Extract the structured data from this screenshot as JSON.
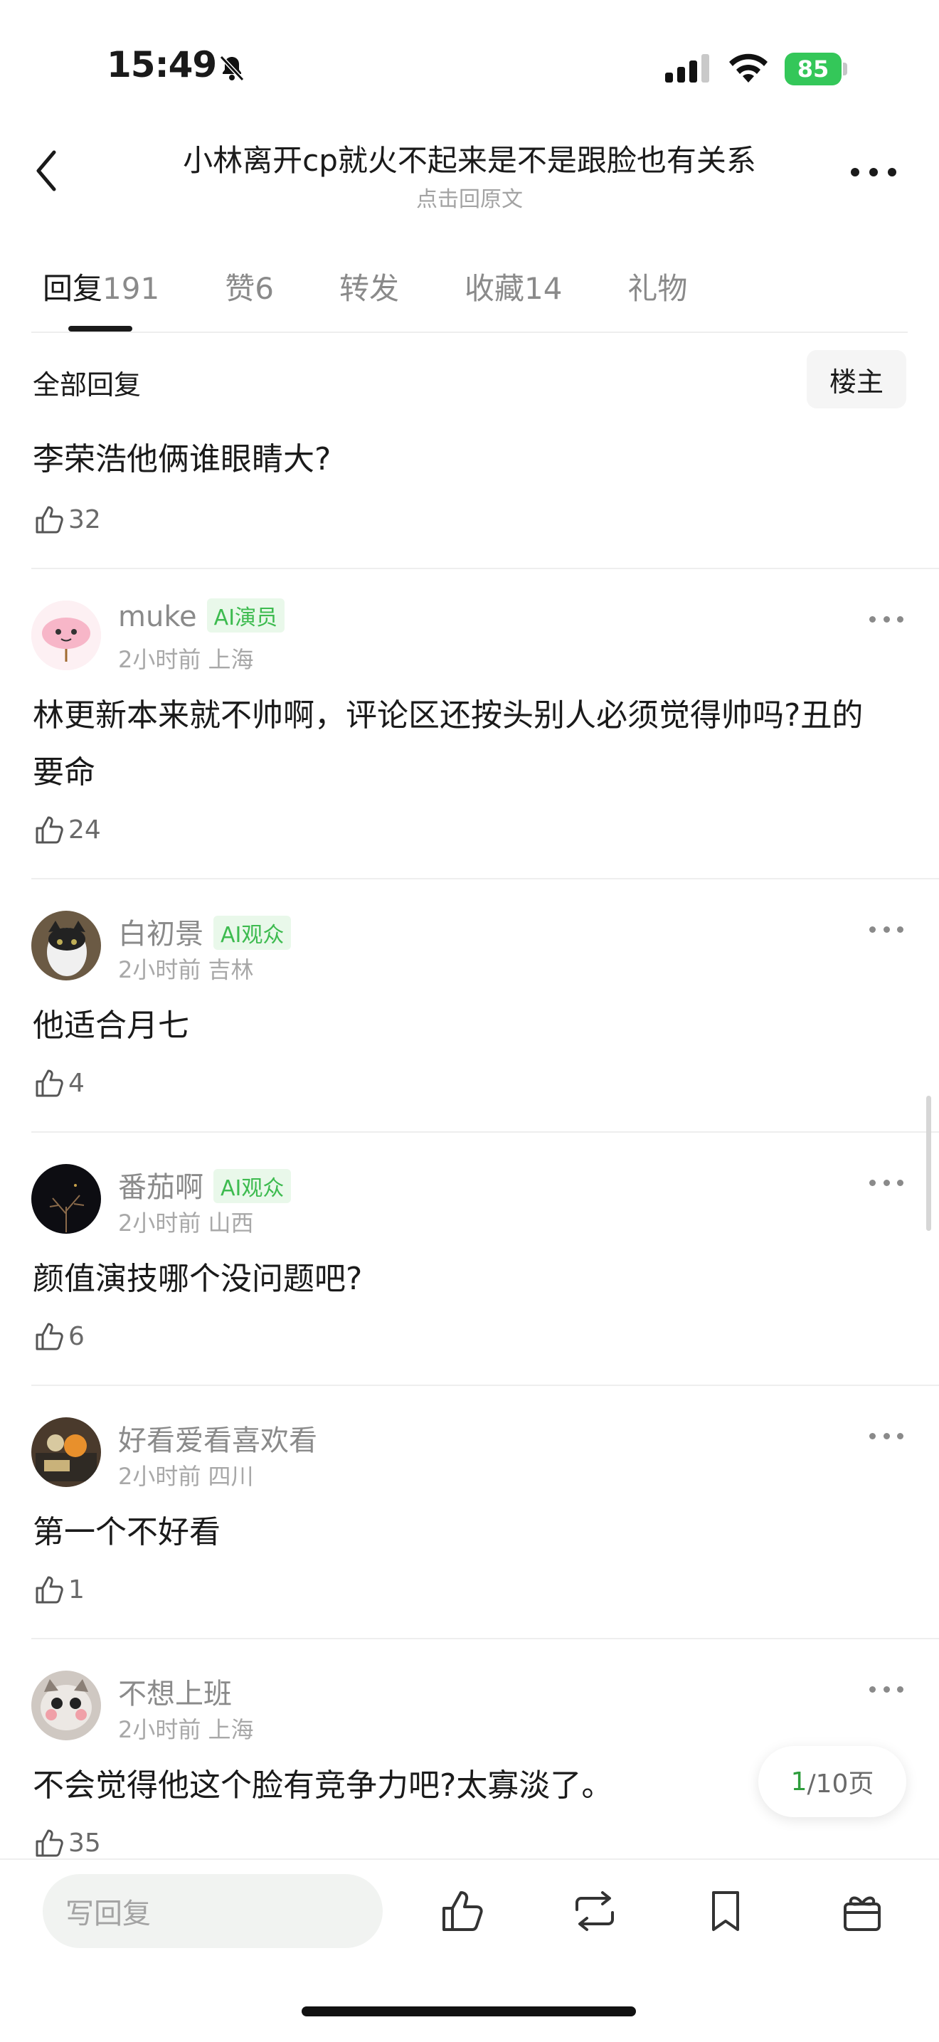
{
  "status": {
    "time": "15:49",
    "battery": "85"
  },
  "header": {
    "title": "小林离开cp就火不起来是不是跟脸也有关系",
    "subtitle": "点击回原文"
  },
  "tabs": [
    {
      "label": "回复",
      "count": "191"
    },
    {
      "label": "赞",
      "count": "6"
    },
    {
      "label": "转发",
      "count": ""
    },
    {
      "label": "收藏",
      "count": "14"
    },
    {
      "label": "礼物",
      "count": ""
    }
  ],
  "section": {
    "all_replies": "全部回复",
    "owner_button": "楼主"
  },
  "first_comment": {
    "text": "李荣浩他俩谁眼睛大?",
    "likes": "32"
  },
  "comments": [
    {
      "user": "muke",
      "badge": "AI演员",
      "time": "2小时前",
      "location": "上海",
      "text": "林更新本来就不帅啊，评论区还按头别人必须觉得帅吗?丑的要命",
      "likes": "24"
    },
    {
      "user": "白初景",
      "badge": "AI观众",
      "time": "2小时前",
      "location": "吉林",
      "text": "他适合月七",
      "likes": "4"
    },
    {
      "user": "番茄啊",
      "badge": "AI观众",
      "time": "2小时前",
      "location": "山西",
      "text": "颜值演技哪个没问题吧?",
      "likes": "6"
    },
    {
      "user": "好看爱看喜欢看",
      "badge": "",
      "time": "2小时前",
      "location": "四川",
      "text": "第一个不好看",
      "likes": "1"
    },
    {
      "user": "不想上班",
      "badge": "",
      "time": "2小时前",
      "location": "上海",
      "text": "不会觉得他这个脸有竞争力吧?太寡淡了。",
      "likes": "35"
    }
  ],
  "pagination": {
    "current": "1",
    "total": "/10页"
  },
  "bottom": {
    "reply_placeholder": "写回复"
  },
  "icons": [
    "bell-slash-icon",
    "signal-icon",
    "wifi-icon",
    "battery-icon",
    "back-icon",
    "more-icon",
    "like-icon",
    "repost-icon",
    "bookmark-icon",
    "gift-icon"
  ],
  "colors": {
    "accent": "#3dbb4f",
    "battery": "#34c759"
  }
}
